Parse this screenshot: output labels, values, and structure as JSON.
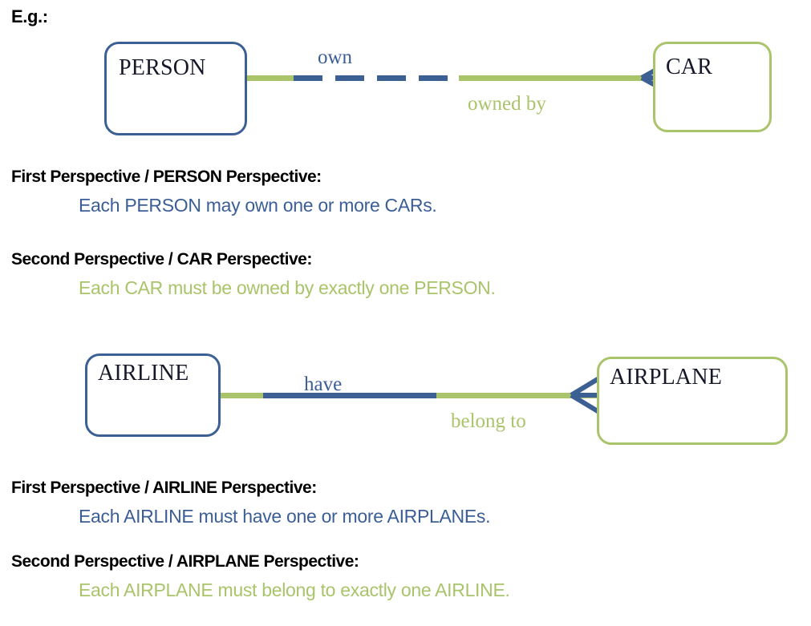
{
  "page": {
    "eg_heading": "E.g.:"
  },
  "colors": {
    "blue_line": "#3c6094",
    "green_line": "#a9c46a",
    "blue_text": "#3c5e96",
    "green_text": "#a9c46a",
    "black_text": "#000000",
    "entity_text": "#16182a"
  },
  "diagrams": [
    {
      "id": "person-car",
      "left_entity": "PERSON",
      "right_entity": "CAR",
      "left_border_color": "#3c6094",
      "right_border_color": "#a9c46a",
      "top_verb": "own",
      "bottom_verb": "owned by",
      "line_style": "dashed-optional",
      "crowfoot_at": "right",
      "perspectives": [
        {
          "title": "First Perspective / PERSON Perspective:",
          "sentence": "Each PERSON may own one or more CARs.",
          "color": "blue"
        },
        {
          "title": "Second Perspective / CAR Perspective:",
          "sentence": "Each CAR must be owned by exactly one PERSON.",
          "color": "green"
        }
      ]
    },
    {
      "id": "airline-airplane",
      "left_entity": "AIRLINE",
      "right_entity": "AIRPLANE",
      "left_border_color": "#3c6094",
      "right_border_color": "#a9c46a",
      "top_verb": "have",
      "bottom_verb": "belong to",
      "line_style": "solid-mandatory",
      "crowfoot_at": "right",
      "perspectives": [
        {
          "title": "First Perspective / AIRLINE Perspective:",
          "sentence": "Each AIRLINE must have one or more AIRPLANEs.",
          "color": "blue"
        },
        {
          "title": "Second Perspective / AIRPLANE Perspective:",
          "sentence": "Each AIRPLANE must belong to exactly one AIRLINE.",
          "color": "green"
        }
      ]
    }
  ]
}
